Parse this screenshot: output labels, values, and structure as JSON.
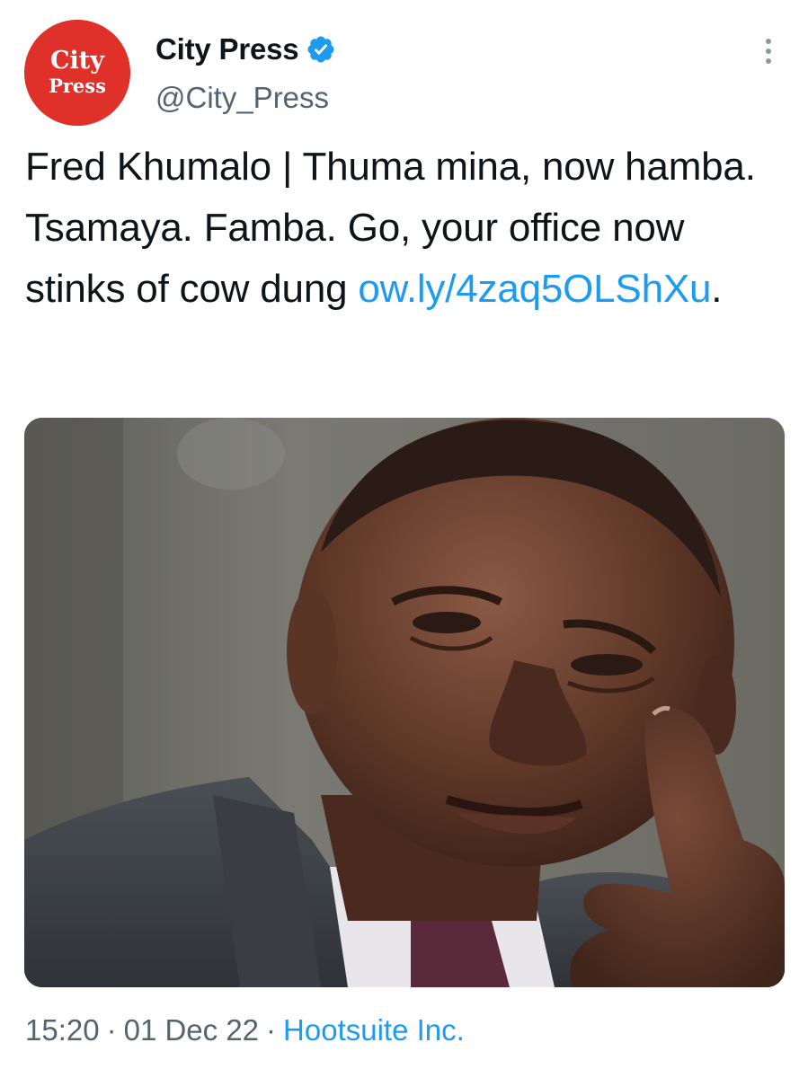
{
  "account": {
    "display_name": "City Press",
    "handle": "@City_Press",
    "avatar_logo_text": [
      "City",
      "Press"
    ],
    "verified_icon": "verified-badge-icon",
    "more_icon": "more-options-icon"
  },
  "tweet": {
    "text": "Fred Khumalo | Thuma mina, now hamba. Tsamaya. Famba. Go, your office now stinks of cow dung",
    "link": "ow.ly/4zaq5OLShXu",
    "trailing": "."
  },
  "meta": {
    "time": "15:20",
    "date": "01 Dec 22",
    "separator": "·",
    "source": "Hootsuite Inc."
  },
  "colors": {
    "brand_red": "#e0302a",
    "link_blue": "#1d9bf0",
    "text_primary": "#0f1419",
    "text_secondary": "#536471",
    "verified_blue": "#1d9bf0"
  }
}
